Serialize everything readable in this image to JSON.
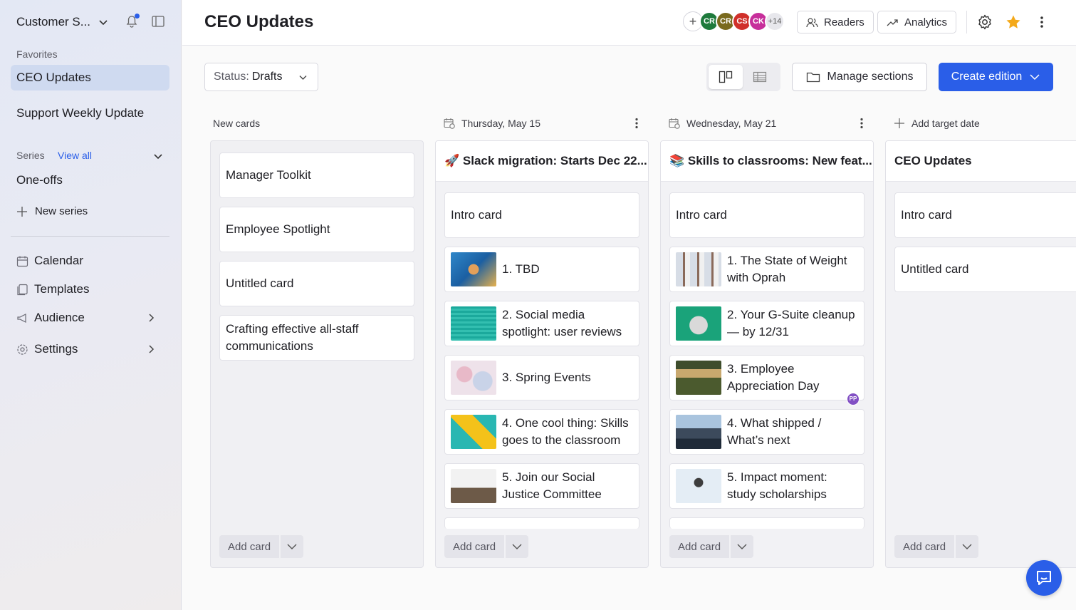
{
  "sidebar": {
    "workspace": "Customer S...",
    "favorites_label": "Favorites",
    "favorites": [
      "CEO Updates",
      "Support Weekly Update"
    ],
    "series_label": "Series",
    "view_all": "View all",
    "one_offs": "One-offs",
    "new_series": "New series",
    "nav": [
      {
        "label": "Calendar",
        "icon": "calendar-icon"
      },
      {
        "label": "Templates",
        "icon": "templates-icon"
      },
      {
        "label": "Audience",
        "icon": "megaphone-icon"
      },
      {
        "label": "Settings",
        "icon": "gear-icon"
      }
    ]
  },
  "header": {
    "title": "CEO Updates",
    "avatars": [
      {
        "initials": "CR",
        "color": "#1e7a3c"
      },
      {
        "initials": "CR",
        "color": "#7a6a1e"
      },
      {
        "initials": "CS",
        "color": "#d0302a"
      },
      {
        "initials": "CK",
        "color": "#c72f9b"
      }
    ],
    "more_count": "+14",
    "readers": "Readers",
    "analytics": "Analytics"
  },
  "toolbar": {
    "status_label": "Status:",
    "status_value": "Drafts",
    "manage_sections": "Manage sections",
    "create_edition": "Create edition"
  },
  "columns": {
    "new_cards": {
      "heading": "New cards",
      "cards": [
        "Manager Toolkit",
        "Employee Spotlight",
        "Untitled card",
        "Crafting effective all-staff communications"
      ],
      "add_card": "Add card"
    },
    "col1": {
      "date": "Thursday, May 15",
      "title": "🚀 Slack migration: Starts Dec 22...",
      "cards": [
        "Intro card",
        "1. TBD",
        "2. Social media spotlight: user reviews",
        "3. Spring Events",
        "4. One cool thing: Skills goes to the classroom",
        "5. Join our Social Justice Committee"
      ],
      "add_card": "Add card"
    },
    "col2": {
      "date": "Wednesday, May 21",
      "title": "📚 Skills to classrooms: New feat...",
      "cards": [
        "Intro card",
        "1. The State of Weight with Oprah",
        "2. Your G-Suite cleanup — by 12/31",
        "3. Employee Appreciation Day",
        "4. What shipped / What’s next",
        "5. Impact moment: study scholarships"
      ],
      "badge": "PP",
      "add_card": "Add card"
    },
    "col3": {
      "add_target_date": "Add target date",
      "title": "CEO Updates",
      "cards": [
        "Intro card",
        "Untitled card"
      ],
      "add_card": "Add card"
    }
  },
  "colors": {
    "accent": "#2a5ee8",
    "sidebar_active": "#cfdaf0"
  }
}
